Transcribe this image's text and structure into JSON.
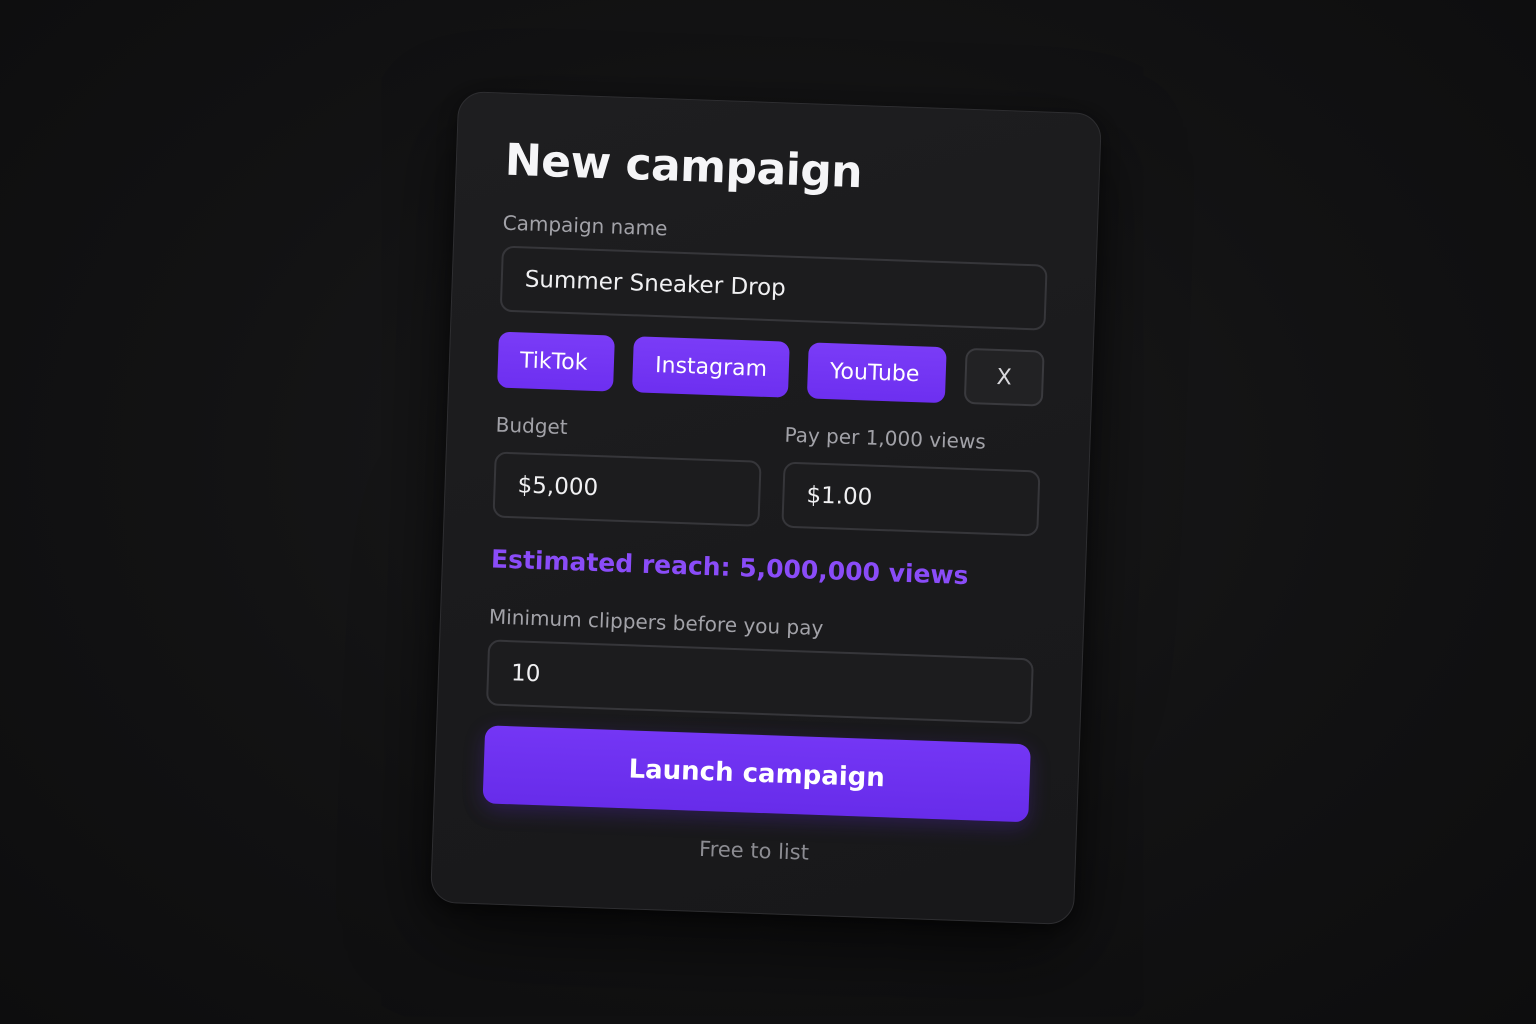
{
  "form": {
    "title": "New campaign",
    "campaign_name": {
      "label": "Campaign name",
      "value": "Summer Sneaker Drop"
    },
    "platforms": [
      {
        "label": "TikTok",
        "selected": true
      },
      {
        "label": "Instagram",
        "selected": true
      },
      {
        "label": "YouTube",
        "selected": true
      },
      {
        "label": "X",
        "selected": false
      }
    ],
    "budget": {
      "label": "Budget",
      "value": "$5,000"
    },
    "pay_rate": {
      "label": "Pay per 1,000 views",
      "value": "$1.00"
    },
    "estimated_reach": "Estimated reach: 5,000,000 views",
    "min_clippers": {
      "label": "Minimum clippers before you pay",
      "value": "10"
    },
    "submit_label": "Launch campaign",
    "footnote": "Free to list"
  },
  "colors": {
    "accent": "#6d2ff0",
    "accent_text": "#8a4cf8",
    "background": "#121213",
    "card": "#1c1c1e"
  }
}
